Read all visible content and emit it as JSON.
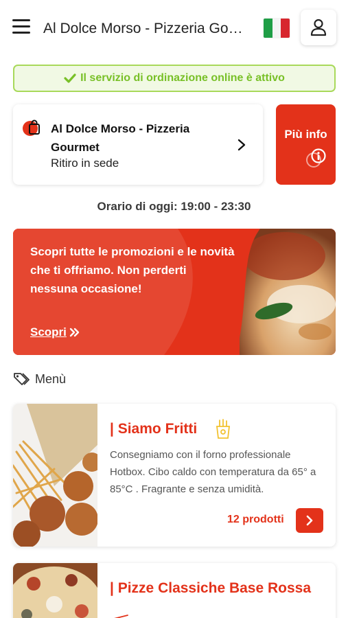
{
  "header": {
    "title": "Al Dolce Morso - Pizzeria Gourmet",
    "flag_icon": "italy-flag-icon",
    "user_icon": "user-icon"
  },
  "status_banner": {
    "text": "Il servizio di ordinazione online è attivo",
    "icon": "check-icon",
    "color": "#78c027"
  },
  "store": {
    "name": "Al Dolce Morso - Pizzeria Gourmet",
    "mode": "Ritiro in sede",
    "icon": "shopping-bag-icon"
  },
  "info_button": {
    "label": "Più info",
    "icon": "info-icon"
  },
  "hours": "Orario di oggi: 19:00 - 23:30",
  "promo": {
    "text": "Scopri tutte le promozioni e le novità che ti offriamo. Non perderti nessuna occasione!",
    "link_label": "Scopri"
  },
  "menu": {
    "label": "Menù",
    "icon": "tag-icon",
    "categories": [
      {
        "title": "| Siamo Fritti",
        "description": "Consegniamo con il forno professionale Hotbox. Cibo caldo con temperatura da 65° a 85°C . Fragrante e senza umidità.",
        "count_label": "12 prodotti",
        "icon": "fries-icon"
      },
      {
        "title": "| Pizze Classiche Base Rossa",
        "description": "",
        "count_label": "",
        "icon": "pizza-icon"
      }
    ]
  },
  "colors": {
    "accent": "#e3321a",
    "success": "#78c027"
  }
}
